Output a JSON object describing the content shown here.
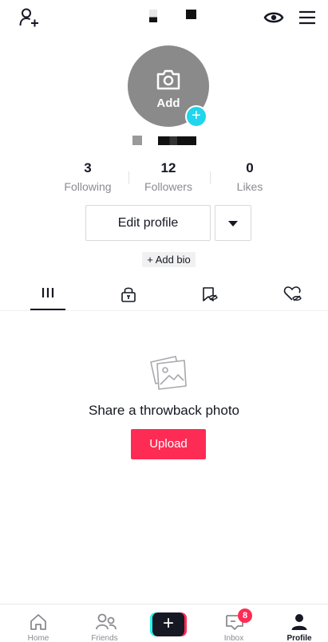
{
  "header": {
    "left_icon": "add-friend-icon",
    "right_icons": [
      "eye-icon",
      "menu-icon"
    ]
  },
  "avatar": {
    "label": "Add",
    "icon": "camera-icon",
    "plus_label": "+"
  },
  "stats": [
    {
      "value": "3",
      "label": "Following"
    },
    {
      "value": "12",
      "label": "Followers"
    },
    {
      "value": "0",
      "label": "Likes"
    }
  ],
  "actions": {
    "edit_profile_label": "Edit profile",
    "dropdown_icon": "triangle-down-icon",
    "add_bio_label": "+ Add bio"
  },
  "tabs": [
    {
      "icon": "grid-icon",
      "active": true
    },
    {
      "icon": "lock-icon",
      "active": false
    },
    {
      "icon": "bookmark-icon",
      "active": false
    },
    {
      "icon": "heart-icon",
      "active": false
    }
  ],
  "empty_state": {
    "icon": "photo-icon",
    "title": "Share a throwback photo",
    "button_label": "Upload"
  },
  "bottom_nav": {
    "items": [
      {
        "label": "Home",
        "icon": "home-icon"
      },
      {
        "label": "Friends",
        "icon": "friends-icon"
      },
      {
        "label": "",
        "icon": "plus-icon"
      },
      {
        "label": "Inbox",
        "icon": "inbox-icon",
        "badge": "8"
      },
      {
        "label": "Profile",
        "icon": "profile-icon"
      }
    ]
  },
  "colors": {
    "accent": "#fe2c55",
    "cyan": "#25f4ee",
    "avatar_plus": "#20d5ec",
    "text": "#161823",
    "secondary_text": "#8a8b91"
  }
}
